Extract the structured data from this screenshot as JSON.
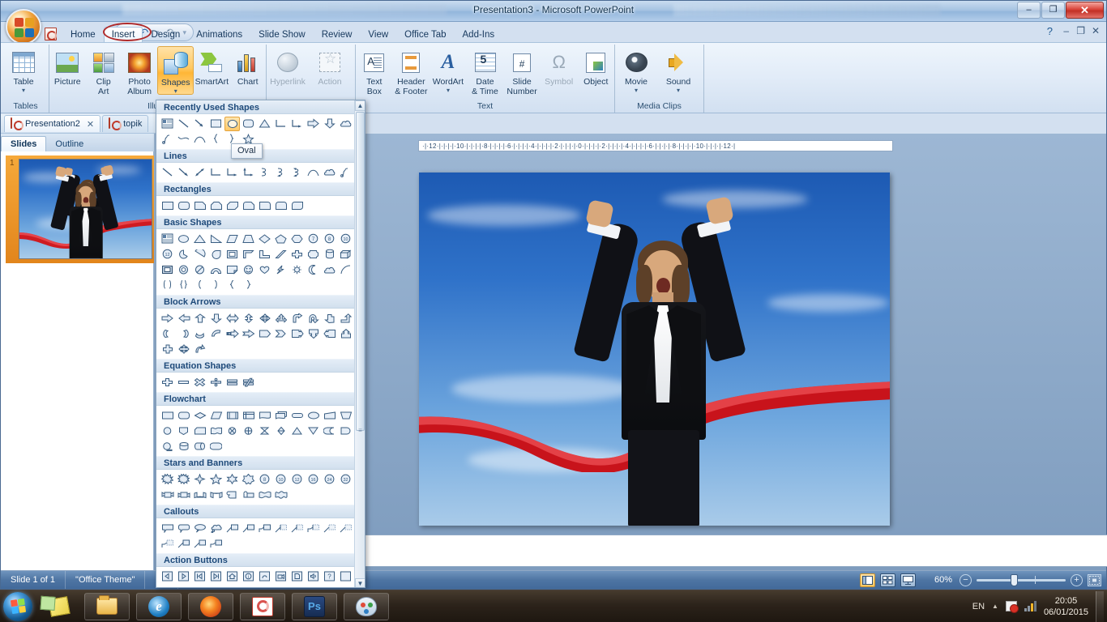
{
  "window": {
    "title": "Presentation3 - Microsoft PowerPoint",
    "minimize": "–",
    "restore": "❐",
    "close": "✕",
    "ribbon_help": "?",
    "ribbon_minimize": "–",
    "ribbon_restore": "❐",
    "ribbon_close": "✕"
  },
  "qat": {
    "save": "save-icon",
    "undo": "↶",
    "redo": "↷",
    "more": "▾"
  },
  "ribbon": {
    "tabs": [
      {
        "label": "Home",
        "active": false
      },
      {
        "label": "Insert",
        "active": true
      },
      {
        "label": "Design",
        "active": false
      },
      {
        "label": "Animations",
        "active": false
      },
      {
        "label": "Slide Show",
        "active": false
      },
      {
        "label": "Review",
        "active": false
      },
      {
        "label": "View",
        "active": false
      },
      {
        "label": "Office Tab",
        "active": false
      },
      {
        "label": "Add-Ins",
        "active": false
      }
    ],
    "groups": [
      {
        "name": "Tables",
        "label": "Tables",
        "items": [
          {
            "label_1": "Table",
            "label_2": "",
            "caret": true,
            "disabled": false,
            "selected": false
          }
        ]
      },
      {
        "name": "Illustrations",
        "label": "Illustr",
        "items": [
          {
            "label_1": "Picture",
            "label_2": "",
            "caret": false,
            "disabled": false,
            "selected": false
          },
          {
            "label_1": "Clip",
            "label_2": "Art",
            "caret": false,
            "disabled": false,
            "selected": false
          },
          {
            "label_1": "Photo",
            "label_2": "Album",
            "caret": true,
            "disabled": false,
            "selected": false
          },
          {
            "label_1": "Shapes",
            "label_2": "",
            "caret": true,
            "disabled": false,
            "selected": true
          },
          {
            "label_1": "SmartArt",
            "label_2": "",
            "caret": false,
            "disabled": false,
            "selected": false
          },
          {
            "label_1": "Chart",
            "label_2": "",
            "caret": false,
            "disabled": false,
            "selected": false
          }
        ]
      },
      {
        "name": "Links",
        "label": "",
        "items": [
          {
            "label_1": "Hyperlink",
            "label_2": "",
            "caret": false,
            "disabled": true,
            "selected": false
          },
          {
            "label_1": "Action",
            "label_2": "",
            "caret": false,
            "disabled": true,
            "selected": false
          }
        ]
      },
      {
        "name": "Text",
        "label": "Text",
        "items": [
          {
            "label_1": "Text",
            "label_2": "Box",
            "caret": false,
            "disabled": false,
            "selected": false
          },
          {
            "label_1": "Header",
            "label_2": "& Footer",
            "caret": false,
            "disabled": false,
            "selected": false
          },
          {
            "label_1": "WordArt",
            "label_2": "",
            "caret": true,
            "disabled": false,
            "selected": false
          },
          {
            "label_1": "Date",
            "label_2": "& Time",
            "caret": false,
            "disabled": false,
            "selected": false
          },
          {
            "label_1": "Slide",
            "label_2": "Number",
            "caret": false,
            "disabled": false,
            "selected": false
          },
          {
            "label_1": "Symbol",
            "label_2": "",
            "caret": false,
            "disabled": true,
            "selected": false
          },
          {
            "label_1": "Object",
            "label_2": "",
            "caret": false,
            "disabled": false,
            "selected": false
          }
        ]
      },
      {
        "name": "MediaClips",
        "label": "Media Clips",
        "items": [
          {
            "label_1": "Movie",
            "label_2": "",
            "caret": true,
            "disabled": false,
            "selected": false
          },
          {
            "label_1": "Sound",
            "label_2": "",
            "caret": true,
            "disabled": false,
            "selected": false
          }
        ]
      }
    ]
  },
  "shapes_gallery": {
    "tooltip": "Oval",
    "scroll_up": "▲",
    "scroll_down": "▼",
    "sections": [
      {
        "heading": "Recently Used Shapes",
        "rows": [
          12,
          6
        ]
      },
      {
        "heading": "Lines",
        "rows": [
          12
        ]
      },
      {
        "heading": "Rectangles",
        "rows": [
          9
        ]
      },
      {
        "heading": "Basic Shapes",
        "rows": [
          12,
          12,
          11,
          6
        ]
      },
      {
        "heading": "Block Arrows",
        "rows": [
          12,
          12,
          3
        ]
      },
      {
        "heading": "Equation Shapes",
        "rows": [
          6
        ]
      },
      {
        "heading": "Flowchart",
        "rows": [
          12,
          12,
          4
        ]
      },
      {
        "heading": "Stars and Banners",
        "rows": [
          12,
          8
        ]
      },
      {
        "heading": "Callouts",
        "rows": [
          12,
          4
        ]
      },
      {
        "heading": "Action Buttons",
        "rows": [
          12
        ]
      }
    ]
  },
  "doc_tabs": [
    {
      "label": "Presentation2",
      "close": "✕",
      "active": true
    },
    {
      "label": "topik",
      "close": "",
      "active": false
    }
  ],
  "pane_tabs": [
    {
      "label": "Slides",
      "active": true
    },
    {
      "label": "Outline",
      "active": false
    }
  ],
  "slide_thumbnails": [
    {
      "number": "1",
      "selected": true
    }
  ],
  "ruler": {
    "text": "·|·12·|·|·|·|·10·|·|·|·|·8·|·|·|·|·6·|·|·|·|·4·|·|·|·|·2·|·|·|·|·0·|·|·|·|·2·|·|·|·|·4·|·|·|·|·6·|·|·|·|·8·|·|·|·|·10·|·|·|·|·12·|"
  },
  "status_bar": {
    "slide_count": "Slide 1 of 1",
    "theme": "\"Office Theme\"",
    "spell_icon": "spell-check-icon",
    "zoom_level": "60%",
    "zoom_out": "−",
    "zoom_in": "+",
    "fit_label": "fit-to-window-icon",
    "views": [
      {
        "name": "normal-view",
        "active": true
      },
      {
        "name": "slide-sorter-view",
        "active": false
      },
      {
        "name": "slide-show-view",
        "active": false
      }
    ]
  },
  "taskbar": {
    "start": "start-orb",
    "items": [
      {
        "name": "sticky-notes"
      },
      {
        "name": "windows-explorer"
      },
      {
        "name": "internet-explorer"
      },
      {
        "name": "mozilla-firefox"
      },
      {
        "name": "microsoft-powerpoint"
      },
      {
        "name": "adobe-photoshop"
      },
      {
        "name": "microsoft-paint"
      }
    ],
    "tray": {
      "language": "EN",
      "show_hidden": "▲",
      "time": "20:05",
      "date": "06/01/2015"
    }
  },
  "colors": {
    "ribbon_accent": "#ffc861",
    "tab_active": "#ffffff",
    "annotation": "#b02a2a",
    "status_bar": "#4e75a3",
    "thumb_select": "#e2851c"
  }
}
